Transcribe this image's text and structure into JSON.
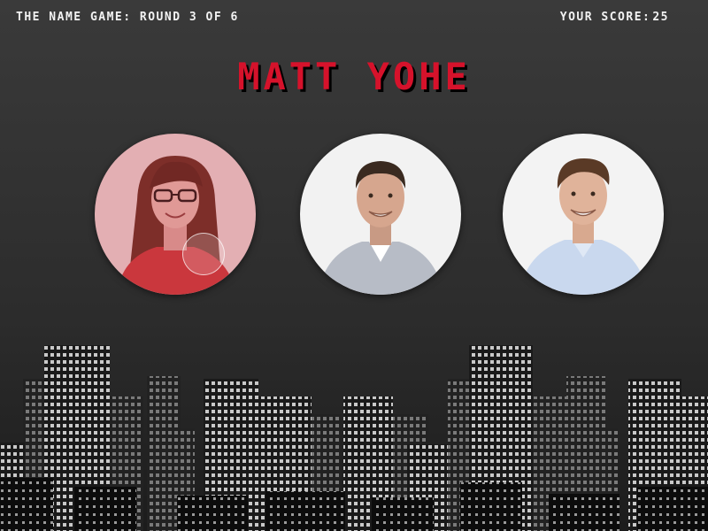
{
  "hud": {
    "round_label": "THE NAME GAME: ROUND 3 OF 6",
    "score_label": "YOUR SCORE:",
    "score_value": "25"
  },
  "prompt": {
    "target_name": "MATT YOHE"
  },
  "choices": [
    {
      "id": "choice-1",
      "highlighted": true,
      "tint": "#e4a7ad"
    },
    {
      "id": "choice-2",
      "highlighted": false,
      "tint": "#f3f3f3"
    },
    {
      "id": "choice-3",
      "highlighted": false,
      "tint": "#f3f3f3"
    }
  ],
  "colors": {
    "name": "#d6122b",
    "background": "#333333"
  }
}
